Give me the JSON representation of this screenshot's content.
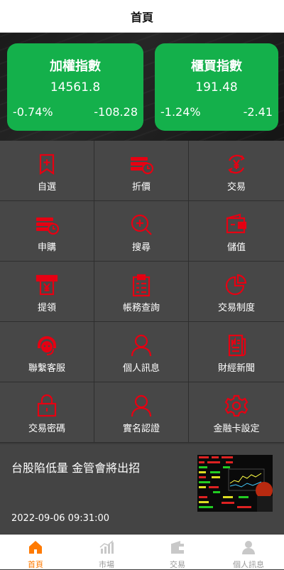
{
  "header": {
    "title": "首頁"
  },
  "indices": [
    {
      "name": "加權指數",
      "value": "14561.8",
      "percent": "-0.74%",
      "change": "-108.28"
    },
    {
      "name": "櫃買指數",
      "value": "191.48",
      "percent": "-1.24%",
      "change": "-2.41"
    }
  ],
  "menu": [
    {
      "label": "自選",
      "icon": "bookmark-plus-icon"
    },
    {
      "label": "折價",
      "icon": "coins-clock-icon"
    },
    {
      "label": "交易",
      "icon": "yen-exchange-icon"
    },
    {
      "label": "申購",
      "icon": "coins-clock-icon"
    },
    {
      "label": "搜尋",
      "icon": "search-plus-icon"
    },
    {
      "label": "儲值",
      "icon": "wallet-icon"
    },
    {
      "label": "提領",
      "icon": "atm-yen-icon"
    },
    {
      "label": "帳務查詢",
      "icon": "clipboard-list-icon"
    },
    {
      "label": "交易制度",
      "icon": "pie-chart-icon"
    },
    {
      "label": "聯繫客服",
      "icon": "customer-service-icon"
    },
    {
      "label": "個人訊息",
      "icon": "user-icon"
    },
    {
      "label": "財經新聞",
      "icon": "newspaper-icon"
    },
    {
      "label": "交易密碼",
      "icon": "lock-icon"
    },
    {
      "label": "實名認證",
      "icon": "user-icon"
    },
    {
      "label": "金融卡設定",
      "icon": "gear-icon"
    }
  ],
  "news": {
    "title": "台股陷低量 金管會將出招",
    "time": "2022-09-06 09:31:00"
  },
  "tabs": [
    {
      "label": "首頁",
      "icon": "home-icon",
      "active": true
    },
    {
      "label": "市場",
      "icon": "market-chart-icon",
      "active": false
    },
    {
      "label": "交易",
      "icon": "wallet-icon",
      "active": false
    },
    {
      "label": "個人訊息",
      "icon": "user-icon",
      "active": false
    }
  ],
  "colors": {
    "accent_red": "#e60012",
    "card_green": "#14b04b",
    "tab_active": "#ff7a00",
    "tab_inactive": "#c8c8c8"
  }
}
